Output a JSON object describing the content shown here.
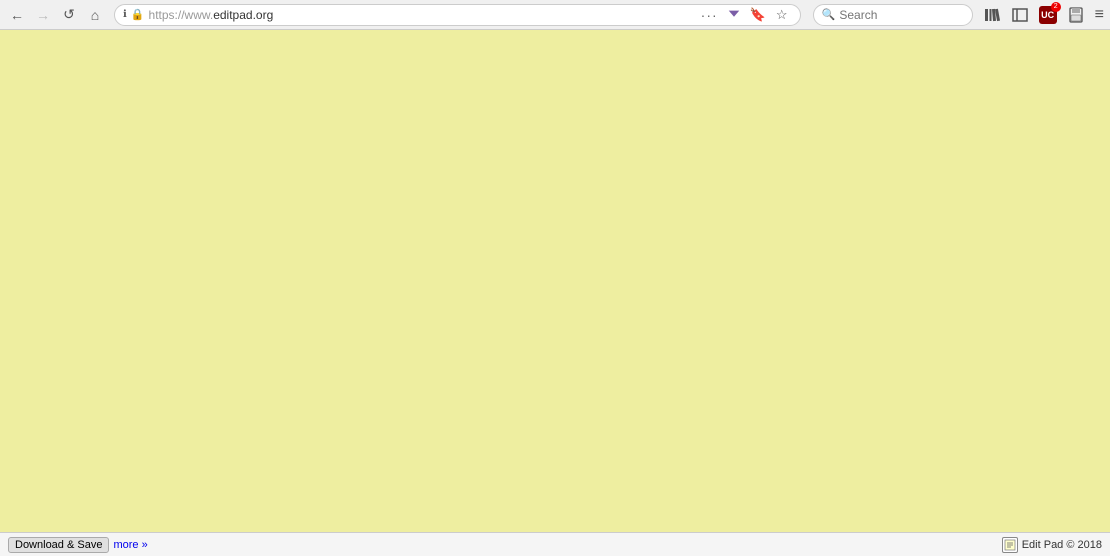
{
  "browser": {
    "url_https": "https://www.",
    "url_domain": "editpad.org",
    "full_url": "https://www.editpad.org",
    "search_placeholder": "Search",
    "nav": {
      "back_label": "←",
      "forward_label": "→",
      "reload_label": "↺",
      "home_label": "⌂"
    },
    "toolbar": {
      "more_label": "···",
      "pocket_label": "pocket",
      "bookmark_label": "🔖",
      "star_label": "☆"
    },
    "right_icons": {
      "library_label": "📚",
      "sidebar_label": "⬜",
      "uc_label": "UC",
      "uc_count": "2",
      "save_page_label": "💾",
      "hamburger_label": "≡"
    }
  },
  "page": {
    "background_color": "#eeeea0"
  },
  "statusbar": {
    "download_save_label": "Download & Save",
    "more_label": "more »",
    "copyright": "Edit Pad © 2018"
  }
}
